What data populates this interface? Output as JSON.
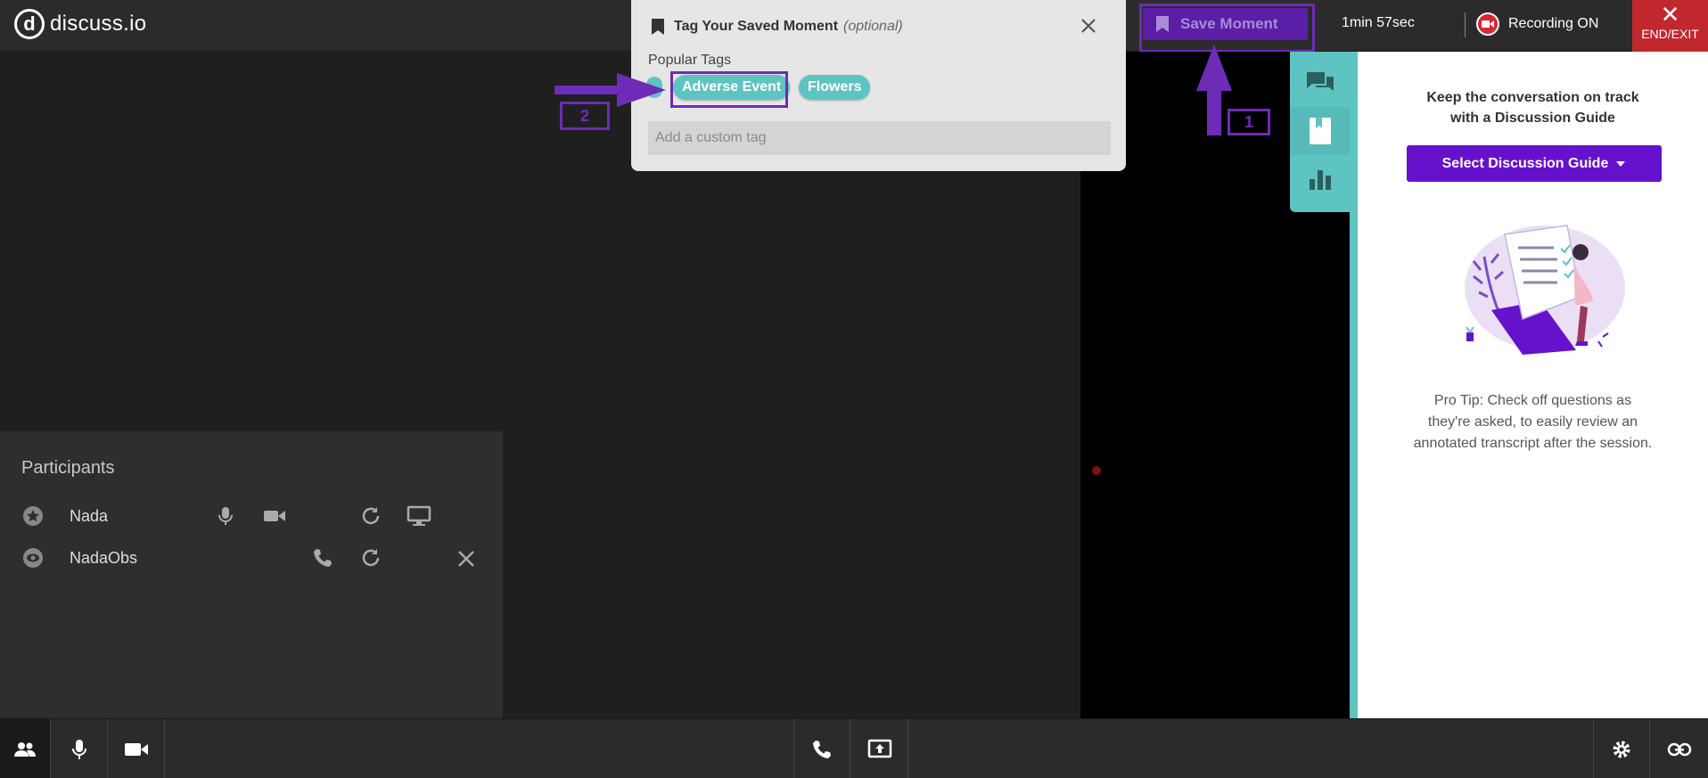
{
  "header": {
    "logo_mark": "d",
    "logo_text": "discuss.io",
    "save_moment_label": "Save Moment",
    "timer": "1min 57sec",
    "recording_label": "Recording ON",
    "end_exit_label": "END/EXIT",
    "end_exit_glyph": "✕"
  },
  "tag_popover": {
    "title": "Tag Your Saved Moment",
    "optional": "(optional)",
    "popular_tags_label": "Popular Tags",
    "tags": [
      "Adverse Event",
      "Flowers"
    ],
    "custom_tag_placeholder": "Add a custom tag"
  },
  "annotations": {
    "step_1": "1",
    "step_2": "2"
  },
  "participants": {
    "heading": "Participants",
    "rows": [
      {
        "name": "Nada",
        "role_icon": "star-icon"
      },
      {
        "name": "NadaObs",
        "role_icon": "eye-icon"
      }
    ]
  },
  "side_tabs": [
    "chat-icon",
    "bookmark-icon",
    "bar-chart-icon"
  ],
  "discussion_guide": {
    "heading": "Keep the conversation on track with a Discussion Guide",
    "button_label": "Select Discussion Guide",
    "pro_tip": "Pro Tip: Check off questions as they're asked, to easily review an annotated transcript after the session."
  },
  "bottom_toolbar": [
    "participants-icon",
    "microphone-icon",
    "camera-icon",
    "phone-icon",
    "screen-share-icon",
    "gear-icon",
    "link-icon"
  ],
  "colors": {
    "accent_purple": "#6611cc",
    "teal": "#5ec4c2",
    "end_red": "#c0282d",
    "annotation_purple": "#6e2bb8"
  }
}
